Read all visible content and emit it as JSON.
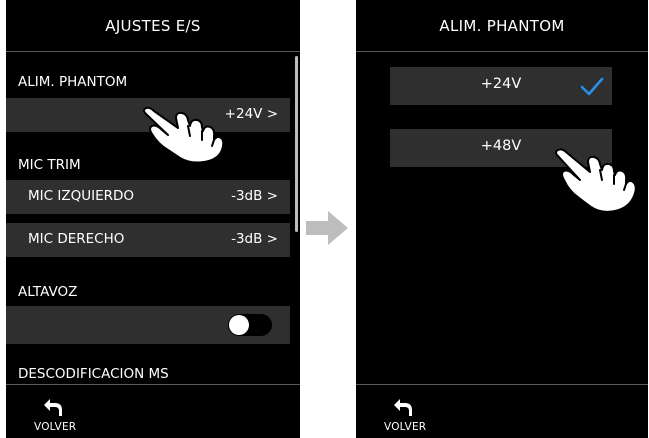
{
  "left_screen": {
    "title": "AJUSTES E/S",
    "phantom": {
      "label": "ALIM. PHANTOM",
      "value": "+24V >"
    },
    "mic_trim": {
      "label": "MIC TRIM",
      "rows": [
        {
          "label": "MIC IZQUIERDO",
          "value": "-3dB >"
        },
        {
          "label": "MIC DERECHO",
          "value": "-3dB >"
        }
      ]
    },
    "speaker": {
      "label": "ALTAVOZ",
      "enabled": false
    },
    "ms_decode": {
      "label": "DESCODIFICACION MS"
    },
    "back_label": "VOLVER"
  },
  "right_screen": {
    "title": "ALIM. PHANTOM",
    "options": [
      {
        "label": "+24V",
        "selected": true
      },
      {
        "label": "+48V",
        "selected": false
      }
    ],
    "back_label": "VOLVER"
  },
  "colors": {
    "screen_bg": "#000000",
    "row_bg": "#2f2f2f",
    "check": "#2a8fe8",
    "arrow": "#bdbdbd"
  },
  "icons": [
    "back-arrow-icon",
    "check-icon",
    "tap-hand-icon",
    "right-arrow-icon",
    "toggle-switch"
  ]
}
